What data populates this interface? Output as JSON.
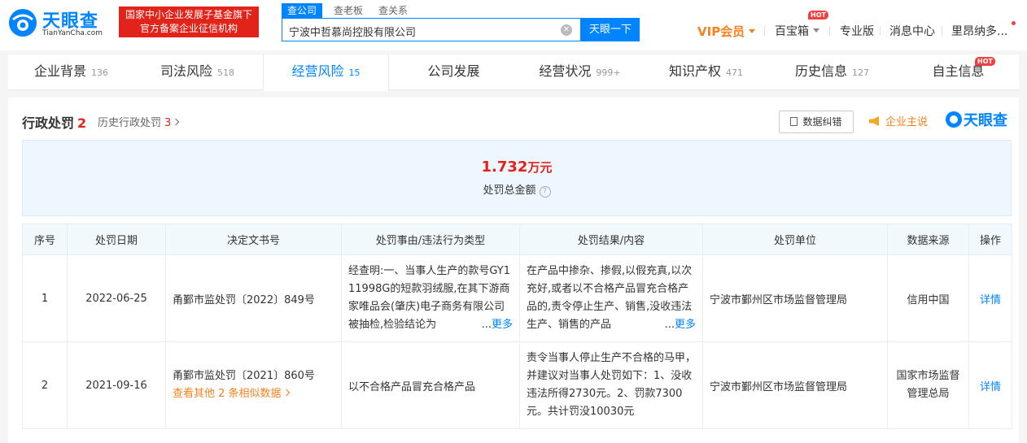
{
  "header": {
    "logo_text": "天眼查",
    "logo_sub": "TianYanCha.com",
    "promo_line1": "国家中小企业发展子基金旗下",
    "promo_line2": "官方备案企业征信机构",
    "search_tabs": [
      "查公司",
      "查老板",
      "查关系"
    ],
    "search_value": "宁波中哲慕尚控股有限公司",
    "search_button": "天眼一下",
    "nav": {
      "vip": "VIP会员",
      "baibaoxiang": "百宝箱",
      "pro": "专业版",
      "messages": "消息中心",
      "user": "里昂纳多..."
    },
    "hot_badge": "HOT"
  },
  "tabs": [
    {
      "label": "企业背景",
      "count": "136"
    },
    {
      "label": "司法风险",
      "count": "518"
    },
    {
      "label": "经营风险",
      "count": "15"
    },
    {
      "label": "公司发展",
      "count": ""
    },
    {
      "label": "经营状况",
      "count": "999+"
    },
    {
      "label": "知识产权",
      "count": "471"
    },
    {
      "label": "历史信息",
      "count": "127"
    },
    {
      "label": "自主信息",
      "count": ""
    }
  ],
  "section": {
    "title": "行政处罚",
    "count": "2",
    "history_label": "历史行政处罚",
    "history_count": "3",
    "correct_button": "数据纠错",
    "self_promo": "企业主说",
    "brand": "天眼查"
  },
  "summary": {
    "amount": "1.732",
    "unit": "万元",
    "label": "处罚总金额"
  },
  "table": {
    "headers": [
      "序号",
      "处罚日期",
      "决定文书号",
      "处罚事由/违法行为类型",
      "处罚结果/内容",
      "处罚单位",
      "数据来源",
      "操作"
    ],
    "rows": [
      {
        "index": "1",
        "date": "2022-06-25",
        "doc": "甬鄞市监处罚〔2022〕849号",
        "reason": "经查明:一、当事人生产的款号GY111998G的短款羽绒服,在其下游商家唯品会(肇庆)电子商务有限公司被抽检,检验结论为",
        "result": "在产品中掺杂、掺假,以假充真,以次充好,或者以不合格产品冒充合格产品的,责令停止生产、销售,没收违法生产、销售的产品",
        "more": "更多",
        "ellipsis": "...",
        "unit": "宁波市鄞州区市场监督管理局",
        "source": "信用中国",
        "action": "详情"
      },
      {
        "index": "2",
        "date": "2021-09-16",
        "doc": "甬鄞市监处罚〔2021〕860号",
        "similar": "查看其他 2 条相似数据",
        "reason": "以不合格产品冒充合格产品",
        "result": "责令当事人停止生产不合格的马甲，并建议对当事人处罚如下：1、没收违法所得2730元。2、罚款7300元。共计罚没10030元",
        "unit": "宁波市鄞州区市场监督管理局",
        "source": "国家市场监督管理总局",
        "action": "详情"
      }
    ]
  }
}
